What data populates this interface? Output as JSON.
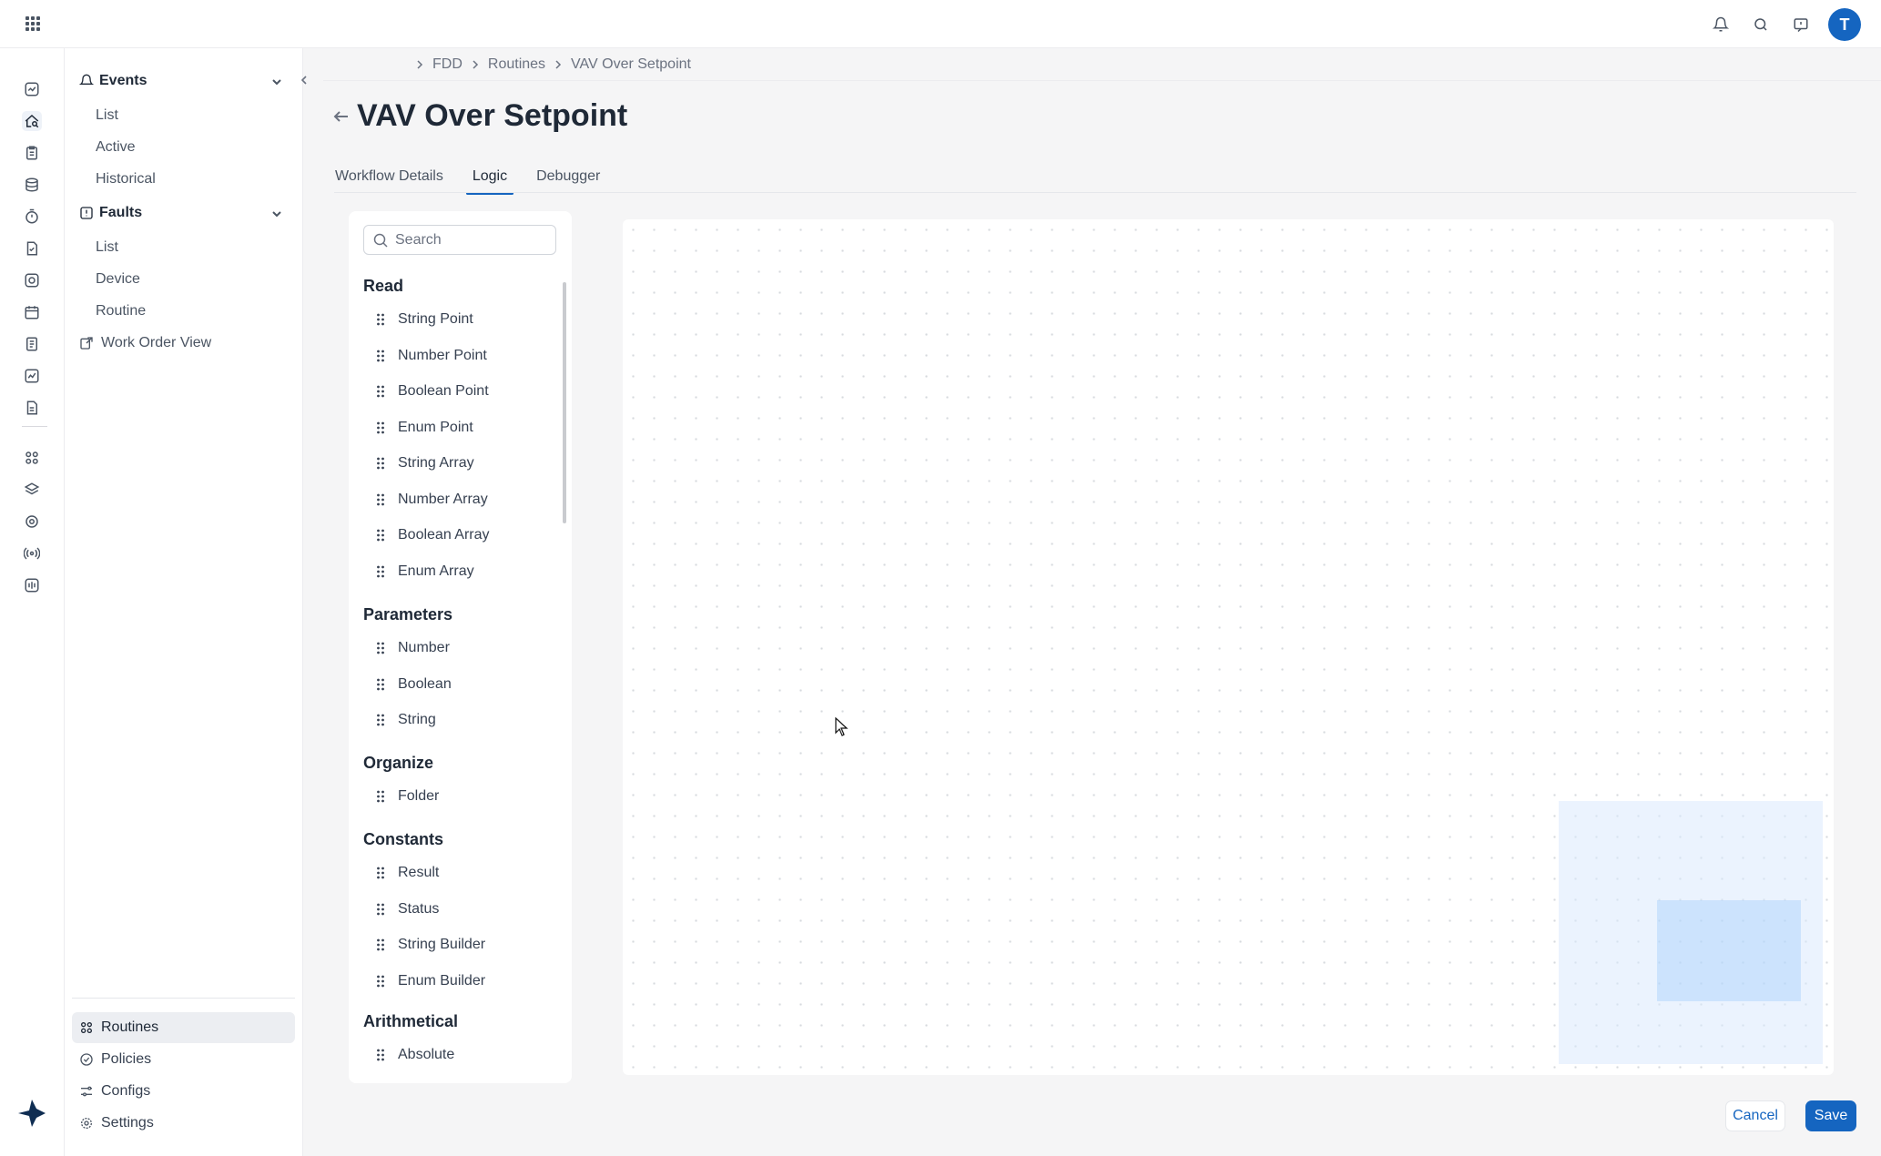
{
  "colors": {
    "accent": "#1565c0",
    "canvas_bg": "#ffffff",
    "page_bg": "#f5f5f6"
  },
  "topbar": {
    "apps_icon": "grid-icon",
    "icons": [
      "bell-icon",
      "search-icon",
      "chat-icon"
    ],
    "avatar_initial": "T"
  },
  "rail": {
    "icons": [
      "dashboard-icon",
      "fdd-icon",
      "clipboard-icon",
      "database-icon",
      "timer-icon",
      "document-icon",
      "camera-icon",
      "calendar-icon",
      "list-icon",
      "chart-icon",
      "report-icon",
      "apps-icon",
      "layers-icon",
      "cog-icon",
      "broadcast-icon",
      "meter-icon"
    ]
  },
  "nav": {
    "events": {
      "label": "Events",
      "items": [
        "List",
        "Active",
        "Historical"
      ]
    },
    "faults": {
      "label": "Faults",
      "items": [
        "List",
        "Device",
        "Routine"
      ]
    },
    "work_order_view": "Work Order View",
    "bottom": [
      "Routines",
      "Policies",
      "Configs",
      "Settings"
    ]
  },
  "breadcrumb": [
    "FDD",
    "Routines",
    "VAV Over Setpoint"
  ],
  "page": {
    "title": "VAV Over Setpoint"
  },
  "tabs": [
    "Workflow Details",
    "Logic",
    "Debugger"
  ],
  "active_tab": "Logic",
  "palette": {
    "search_placeholder": "Search",
    "read": {
      "label": "Read",
      "items": [
        "String Point",
        "Number Point",
        "Boolean Point",
        "Enum Point",
        "String Array",
        "Number Array",
        "Boolean Array",
        "Enum Array"
      ]
    },
    "parameters": {
      "label": "Parameters",
      "items": [
        "Number",
        "Boolean",
        "String"
      ]
    },
    "organize": {
      "label": "Organize",
      "items": [
        "Folder"
      ]
    },
    "constants": {
      "label": "Constants",
      "items": [
        "Result",
        "Status",
        "String Builder",
        "Enum Builder"
      ]
    },
    "arithmetical": {
      "label": "Arithmetical",
      "items": [
        "Absolute"
      ]
    }
  },
  "actions": {
    "cancel": "Cancel",
    "save": "Save"
  }
}
